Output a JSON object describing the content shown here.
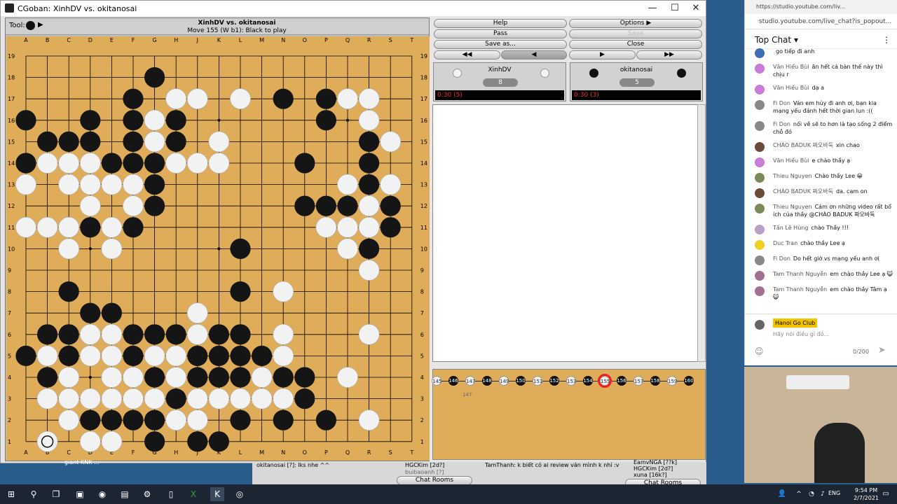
{
  "window": {
    "title": "CGoban: XinhDV vs. okitanosai"
  },
  "board": {
    "tool_label": "Tool:",
    "line1": "XinhDV vs. okitanosai",
    "line2": "Move 155 (W b1): Black to play",
    "cols": [
      "A",
      "B",
      "C",
      "D",
      "E",
      "F",
      "G",
      "H",
      "J",
      "K",
      "L",
      "M",
      "N",
      "O",
      "P",
      "Q",
      "R",
      "S",
      "T"
    ],
    "rows": [
      "19",
      "18",
      "17",
      "16",
      "15",
      "14",
      "13",
      "12",
      "11",
      "10",
      "9",
      "8",
      "7",
      "6",
      "5",
      "4",
      "3",
      "2",
      "1"
    ],
    "black": [
      "G18",
      "F17",
      "N17",
      "P17",
      "A16",
      "D16",
      "F16",
      "H16",
      "P16",
      "B15",
      "C15",
      "D15",
      "F15",
      "H15",
      "R15",
      "A14",
      "E14",
      "F14",
      "G14",
      "O14",
      "R14",
      "G13",
      "R13",
      "G12",
      "O12",
      "P12",
      "Q12",
      "S12",
      "D11",
      "F11",
      "S11",
      "R10",
      "L10",
      "C8",
      "L8",
      "D7",
      "E7",
      "B6",
      "C6",
      "F6",
      "G6",
      "H6",
      "K6",
      "L6",
      "A5",
      "C5",
      "F5",
      "J5",
      "K5",
      "L5",
      "M5",
      "B4",
      "G4",
      "J4",
      "K4",
      "L4",
      "N4",
      "O4",
      "H3",
      "O3",
      "D2",
      "E2",
      "F2",
      "G2",
      "L2",
      "N2",
      "P2",
      "G1",
      "J1",
      "K1"
    ],
    "white": [
      "H17",
      "J17",
      "L17",
      "Q17",
      "R17",
      "G16",
      "R16",
      "G15",
      "K15",
      "S15",
      "B14",
      "C14",
      "D14",
      "H14",
      "J14",
      "K14",
      "A13",
      "C13",
      "D13",
      "E13",
      "F13",
      "Q13",
      "S13",
      "D12",
      "F12",
      "R12",
      "A11",
      "B11",
      "C11",
      "E11",
      "P11",
      "Q11",
      "R11",
      "C10",
      "E10",
      "Q10",
      "R9",
      "N8",
      "J7",
      "D6",
      "E6",
      "J6",
      "N6",
      "R6",
      "B5",
      "D5",
      "E5",
      "G5",
      "H5",
      "N5",
      "C4",
      "E4",
      "F4",
      "H4",
      "M4",
      "Q4",
      "B3",
      "C3",
      "D3",
      "E3",
      "F3",
      "G3",
      "J3",
      "K3",
      "L3",
      "M3",
      "N3",
      "C2",
      "H2",
      "J2",
      "R2",
      "B1",
      "D1",
      "E1"
    ],
    "last_move": "B1",
    "star_points": [
      "D16",
      "K16",
      "Q16",
      "D10",
      "K10",
      "Q10",
      "D4",
      "K4",
      "Q4"
    ]
  },
  "controls": {
    "help": "Help",
    "options": "Options",
    "pass": "Pass",
    "save": "Save",
    "save_as": "Save as...",
    "close": "Close"
  },
  "players": {
    "white": {
      "name": "XinhDV",
      "captures": "8",
      "clock": "0:30 (5)"
    },
    "black": {
      "name": "okitanosai",
      "captures": "5",
      "clock": "0:30 (3)"
    }
  },
  "tree": {
    "moves": [
      "145",
      "146",
      "147",
      "148",
      "149",
      "150",
      "151",
      "152",
      "153",
      "154",
      "155",
      "156",
      "157",
      "158",
      "159",
      "160"
    ],
    "current": "155",
    "branch": "147"
  },
  "youtube": {
    "tab_url": "https://studio.youtube.com/liv...",
    "url": "studio.youtube.com/live_chat?is_popout...",
    "header": "Top Chat",
    "messages": [
      {
        "author": "",
        "text": "go tiếp đi anh",
        "color": "#3d6fb4"
      },
      {
        "author": "Văn Hiếu Bùi",
        "text": "ăn hết cả bàn thế này thì chịu r",
        "color": "#c87bd9"
      },
      {
        "author": "Văn Hiếu Bùi",
        "text": "dạ a",
        "color": "#c87bd9"
      },
      {
        "author": "Fi Don",
        "text": "Ván em hủy đi anh ơi, bạn kia mạng yếu đánh hết thời gian lun :((",
        "color": "#888"
      },
      {
        "author": "Fi Don",
        "text": "nối về sẽ to hơn là tạo sống 2 điểm chỗ đó",
        "color": "#888"
      },
      {
        "author": "CHÀO BADUK 짜오바둑",
        "text": "xin chao",
        "color": "#6b4a3a"
      },
      {
        "author": "Văn Hiếu Bùi",
        "text": "e chào thầy ạ",
        "color": "#c87bd9"
      },
      {
        "author": "Thieu Nguyen",
        "text": "Chào thầy Lee 😀",
        "color": "#7a8a5a"
      },
      {
        "author": "CHÀO BADUK 짜오바둑",
        "text": "da. cam on",
        "color": "#6b4a3a"
      },
      {
        "author": "Thieu Nguyen",
        "text": "Cám ơn những video rất bổ ích của thầy @CHÀO BADUK 짜오바둑",
        "color": "#7a8a5a"
      },
      {
        "author": "Tấn Lê Hùng",
        "text": "chào Thầy !!!",
        "color": "#b8a0c8"
      },
      {
        "author": "Duc Tran",
        "text": "chào thầy Lee ạ",
        "color": "#f0d020"
      },
      {
        "author": "Fi Don",
        "text": "Do hết giờ vs mạng yếu anh ơi",
        "color": "#888"
      },
      {
        "author": "Tam Thanh Nguyễn",
        "text": "em chào thầy Lee ạ 😺",
        "color": "#a07090"
      },
      {
        "author": "Tam Thanh Nguyễn",
        "text": "em chào thầy Tâm ạ 😺",
        "color": "#a07090"
      }
    ],
    "channel": "Hanoi Go Club",
    "input_placeholder": "Hãy nói điều gì đó...",
    "char_count": "0/200"
  },
  "bottom": {
    "left_line": "okitanosai [?]: Iks nhe ^^",
    "user1": "HGCKim [2d?]",
    "user2": "buibaoanh [?]",
    "chat_rooms": "Chat Rooms",
    "right_line": "TamThanh: k biết có ai review ván mình k nhỉ :v",
    "user3": "EamvNGA [??k]",
    "user4": "HGCKim [2d?]",
    "user5": "xuna [16k?]",
    "left_stub": "giant KNK ..."
  },
  "taskbar": {
    "lang": "ENG",
    "time": "9:54 PM",
    "date": "2/7/2021"
  }
}
